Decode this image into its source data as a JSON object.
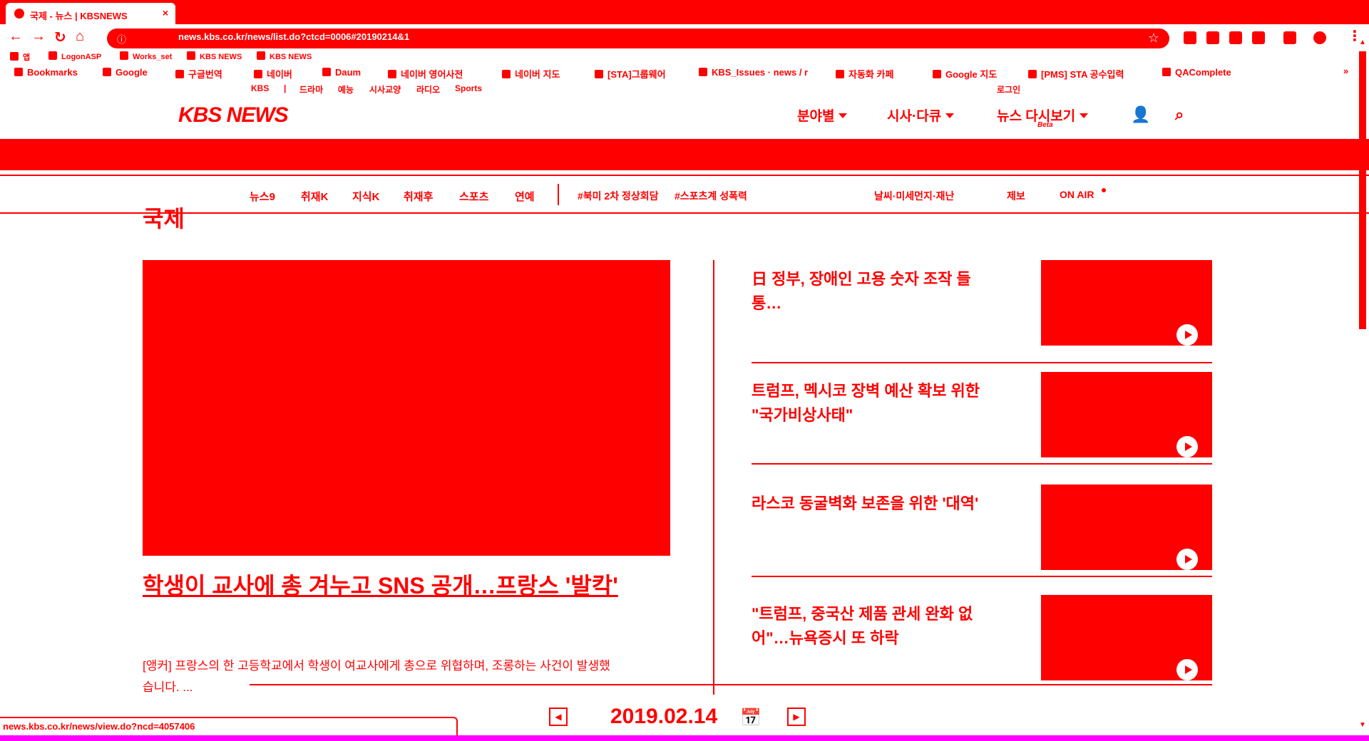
{
  "browser": {
    "tab_title": "국제 - 뉴스 | KBSNEWS",
    "url": "news.kbs.co.kr/news/list.do?ctcd=0006#20190214&1",
    "bookmarks_row1": [
      "앱",
      "LogonASP",
      "Works_set",
      "KBS NEWS",
      "KBS NEWS"
    ],
    "bookmarks_row2": [
      "Bookmarks",
      "Google",
      "구글번역",
      "네이버",
      "Daum",
      "네이버 영어사전",
      "네이버 지도",
      "[STA]그룹웨어",
      "KBS_Issues · news / r",
      "자동화 카페",
      "Google 지도",
      "[PMS] STA 공수입력",
      "QAComplete"
    ],
    "more": "»"
  },
  "util_nav": {
    "items": [
      "KBS",
      "|",
      "드라마",
      "예능",
      "시사교양",
      "라디오",
      "Sports"
    ],
    "login": "로그인"
  },
  "header": {
    "logo": "KBS NEWS",
    "nav": [
      "분야별",
      "시사·다큐",
      "뉴스 다시보기"
    ],
    "beta": "Beta"
  },
  "subnav": {
    "left": [
      "뉴스9",
      "취재K",
      "지식K",
      "취재후",
      "스포츠",
      "연예"
    ],
    "tags": [
      "#북미 2차 정상회담",
      "#스포츠계 성폭력"
    ],
    "right": [
      "날씨·미세먼지·재난",
      "제보",
      "ON AIR"
    ]
  },
  "page": {
    "title": "국제"
  },
  "hero": {
    "title": "학생이 교사에 총 겨누고 SNS 공개…프랑스 '발칵'",
    "desc": "[앵커] 프랑스의 한 고등학교에서 학생이 여교사에게 총으로 위협하며, 조롱하는 사건이 발생했습니다. ..."
  },
  "news_list": [
    {
      "title": "日 정부, 장애인 고용 숫자 조작 들통…"
    },
    {
      "title": "트럼프, 멕시코 장벽 예산 확보 위한 \"국가비상사태\""
    },
    {
      "title": "라스코 동굴벽화 보존을 위한 '대역'"
    },
    {
      "title": "\"트럼프, 중국산 제품 관세 완화 없어\"…뉴욕증시 또 하락"
    }
  ],
  "date_nav": {
    "prev": "◀",
    "date": "2019.02.14",
    "next": "▶"
  },
  "status_bar": {
    "url": "news.kbs.co.kr/news/view.do?ncd=4057406"
  },
  "colors": {
    "primary": "#ff0000",
    "background": "#ffffff",
    "bottom_strip": "#ff00ff"
  }
}
